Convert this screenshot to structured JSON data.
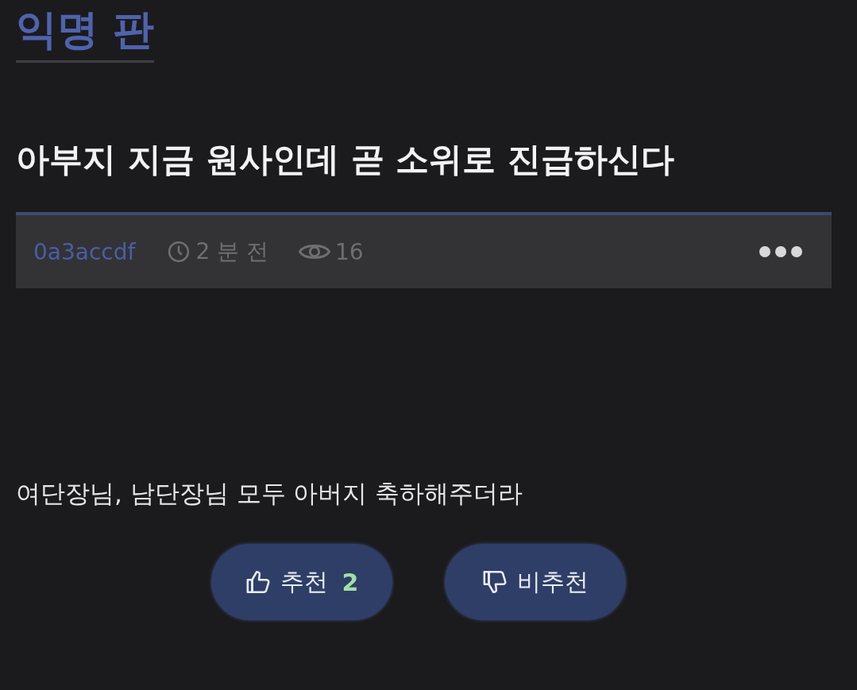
{
  "board": {
    "title": "익명 판"
  },
  "post": {
    "title": "아부지 지금 원사인데 곧 소위로 진급하신다",
    "meta": {
      "author": "0a3accdf",
      "time": "2 분 전",
      "views": "16"
    },
    "body": "여단장님, 남단장님 모두 아버지 축하해주더라",
    "votes": [
      {
        "kind": "up",
        "label": "추천",
        "count": "2"
      },
      {
        "kind": "down",
        "label": "비추천"
      }
    ]
  }
}
